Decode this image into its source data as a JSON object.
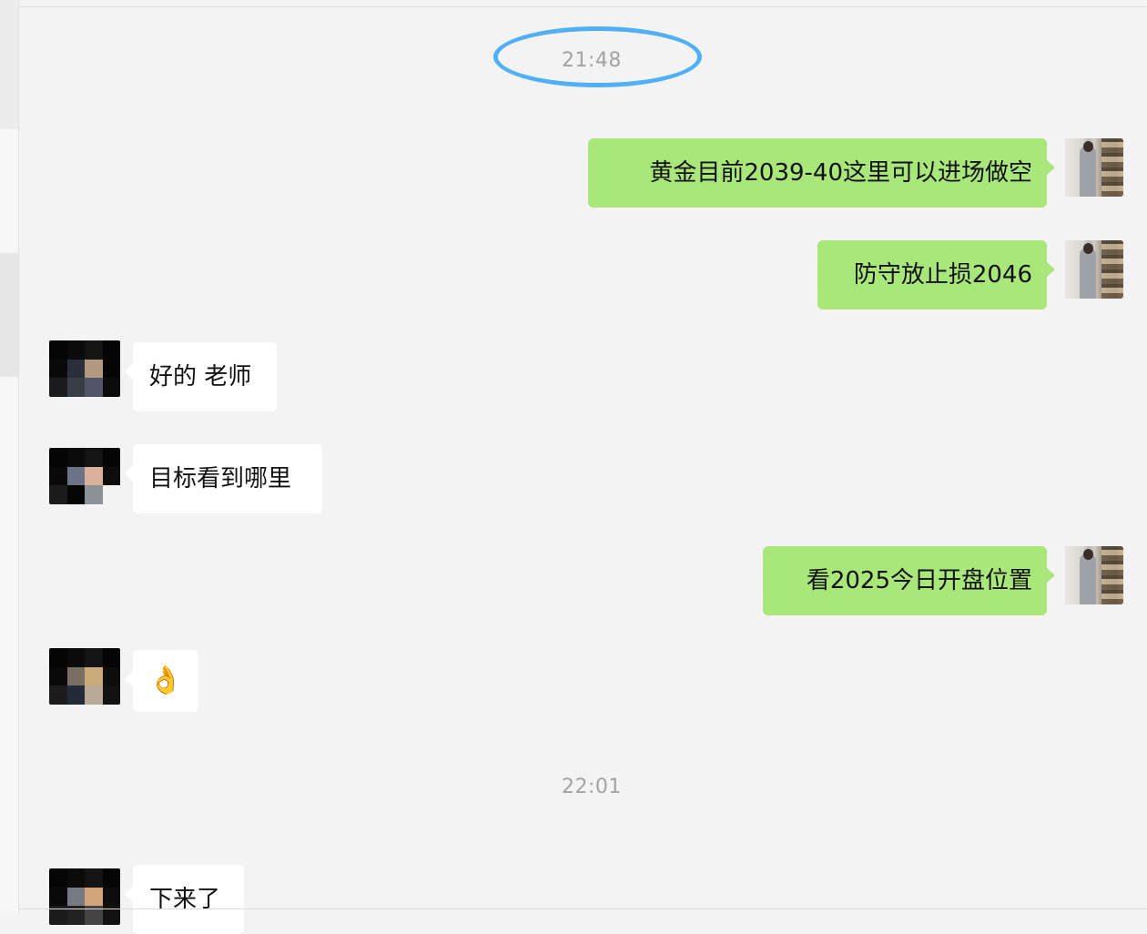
{
  "timestamps": {
    "first": "21:48",
    "second": "22:01"
  },
  "messages": [
    {
      "side": "out",
      "text": "黄金目前2039-40这里可以进场做空"
    },
    {
      "side": "out",
      "text": "防守放止损2046"
    },
    {
      "side": "in",
      "text": "好的 老师"
    },
    {
      "side": "in",
      "text": "目标看到哪里"
    },
    {
      "side": "out",
      "text": "看2025今日开盘位置"
    },
    {
      "side": "in",
      "text": "👌"
    },
    {
      "side": "in",
      "text": "下来了"
    }
  ],
  "colors": {
    "background": "#f3f3f3",
    "outgoing_bubble": "#a9e77a",
    "incoming_bubble": "#ffffff",
    "timestamp_text": "#a3a3a3",
    "highlight_ring": "#4fb0f6"
  },
  "icons": {
    "emoji_ok": "ok-hand-emoji"
  }
}
